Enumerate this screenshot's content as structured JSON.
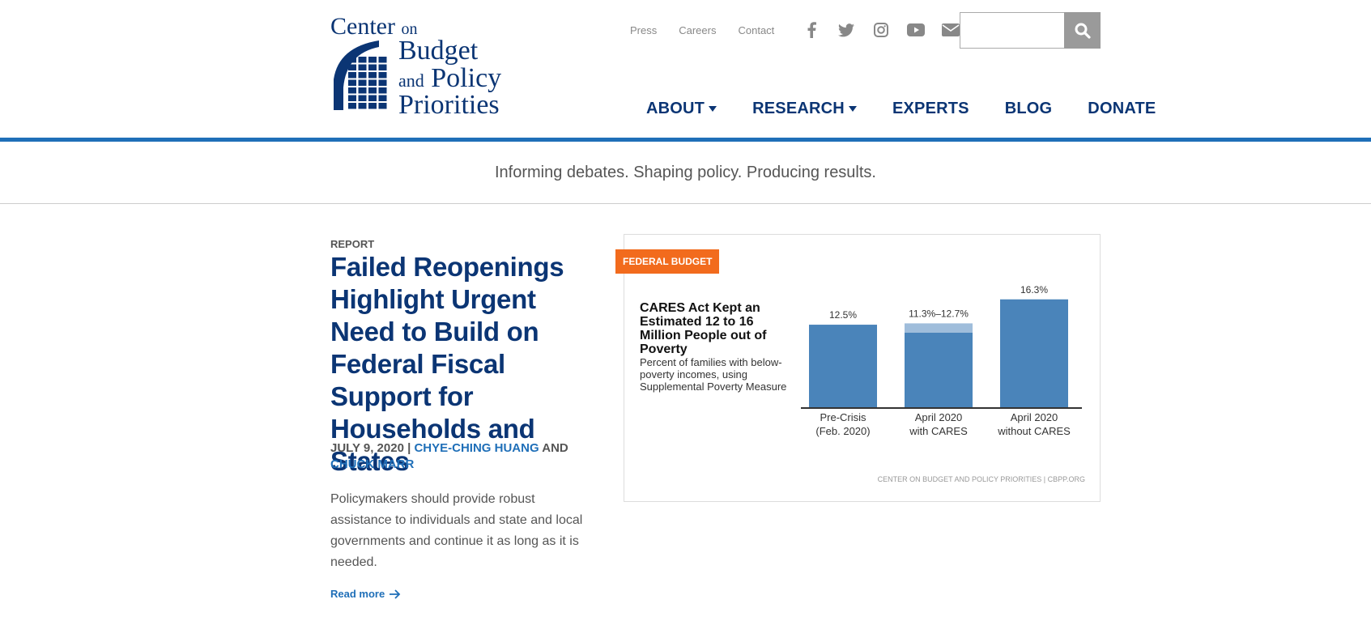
{
  "logo": {
    "line1": "Center",
    "line1b": "on",
    "line2": "Budget",
    "line3a": "and",
    "line3b": "Policy",
    "line4": "Priorities"
  },
  "utility_links": [
    "Press",
    "Careers",
    "Contact"
  ],
  "social_icons": [
    "facebook-icon",
    "twitter-icon",
    "instagram-icon",
    "youtube-icon",
    "email-icon"
  ],
  "search": {
    "placeholder": ""
  },
  "nav": [
    {
      "label": "ABOUT",
      "has_dropdown": true
    },
    {
      "label": "RESEARCH",
      "has_dropdown": true
    },
    {
      "label": "EXPERTS",
      "has_dropdown": false
    },
    {
      "label": "BLOG",
      "has_dropdown": false
    },
    {
      "label": "DONATE",
      "has_dropdown": false
    }
  ],
  "tagline": "Informing debates. Shaping policy. Producing results.",
  "article": {
    "kind": "REPORT",
    "title": "Failed Reopenings Highlight Urgent Need to Build on Federal Fiscal Support for Households and States",
    "date": "JULY 9, 2020",
    "sep": "|",
    "author1": "CHYE-CHING HUANG",
    "and": "AND",
    "author2": "CHUCK MARR",
    "description": "Policymakers should provide robust assistance to individuals and state and local governments and continue it as long as it is needed.",
    "read_more": "Read more"
  },
  "badge": "FEDERAL BUDGET",
  "colors": {
    "brand": "#0b3574",
    "accent": "#1f6fb8",
    "badge": "#f26b1d",
    "bar": "#4a84ba",
    "bar_light": "#9fbddb"
  },
  "chart_data": {
    "type": "bar",
    "title": "CARES Act Kept an Estimated 12 to 16 Million People out of Poverty",
    "subtitle": "Percent of families with below-poverty incomes, using Supplemental Poverty Measure",
    "categories": [
      [
        "Pre-Crisis",
        "(Feb. 2020)"
      ],
      [
        "April 2020",
        "with CARES"
      ],
      [
        "April 2020",
        "without CARES"
      ]
    ],
    "values": [
      12.5,
      11.3,
      16.3
    ],
    "range_upper": [
      null,
      12.7,
      null
    ],
    "data_labels": [
      "12.5%",
      "11.3%–12.7%",
      "16.3%"
    ],
    "ylim": [
      0,
      17
    ],
    "source": "CENTER ON BUDGET AND POLICY PRIORITIES | CBPP.ORG"
  }
}
